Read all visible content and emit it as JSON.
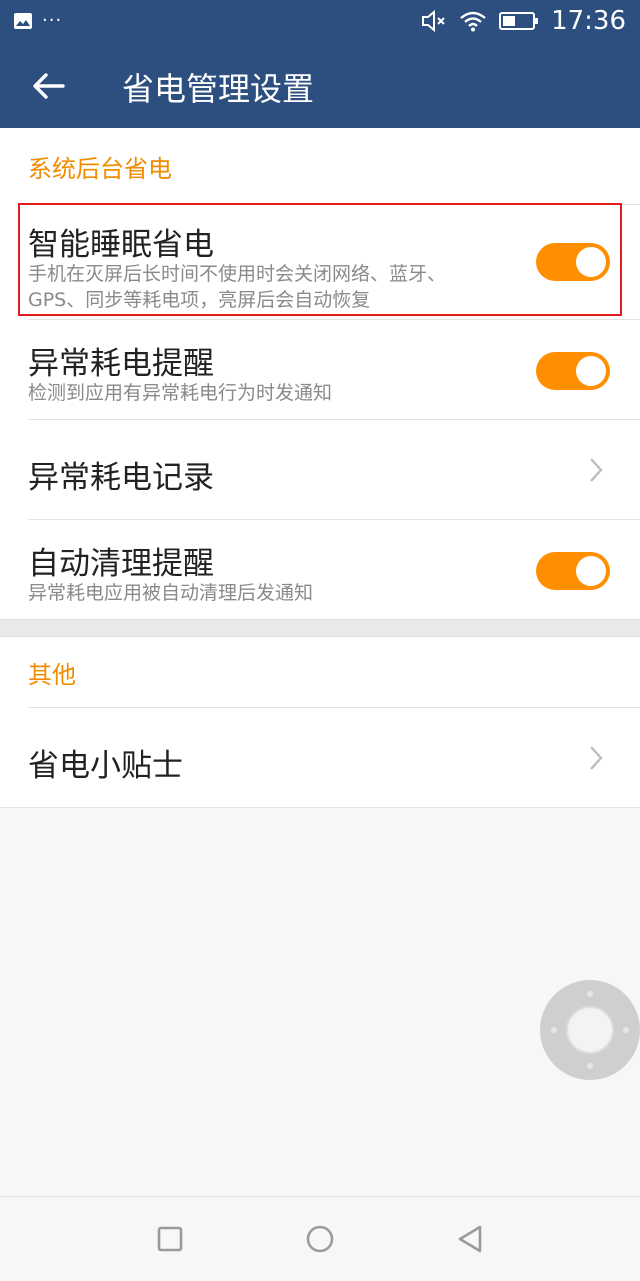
{
  "status_bar": {
    "time": "17:36",
    "dots": "···"
  },
  "toolbar": {
    "title": "省电管理设置"
  },
  "sections": {
    "background": {
      "header": "系统后台省电"
    },
    "other": {
      "header": "其他"
    }
  },
  "items": {
    "smart_sleep": {
      "title": "智能睡眠省电",
      "desc_line1": "手机在灭屏后长时间不使用时会关闭网络、蓝牙、",
      "desc_line2": "GPS、同步等耗电项，亮屏后会自动恢复",
      "enabled": true
    },
    "abnormal_alert": {
      "title": "异常耗电提醒",
      "desc": "检测到应用有异常耗电行为时发通知",
      "enabled": true
    },
    "abnormal_record": {
      "title": "异常耗电记录"
    },
    "auto_clean": {
      "title": "自动清理提醒",
      "desc": "异常耗电应用被自动清理后发通知",
      "enabled": true
    },
    "tips": {
      "title": "省电小贴士"
    }
  },
  "colors": {
    "accent": "#ff8f00",
    "header_text": "#f08c00",
    "toolbar": "#2c4f80",
    "highlight": "#e21b1b"
  },
  "icons": {
    "back": "arrow-left-icon",
    "chevron": "chevron-right-icon",
    "wifi": "wifi-icon",
    "battery": "battery-icon",
    "mute": "volume-mute-icon"
  }
}
